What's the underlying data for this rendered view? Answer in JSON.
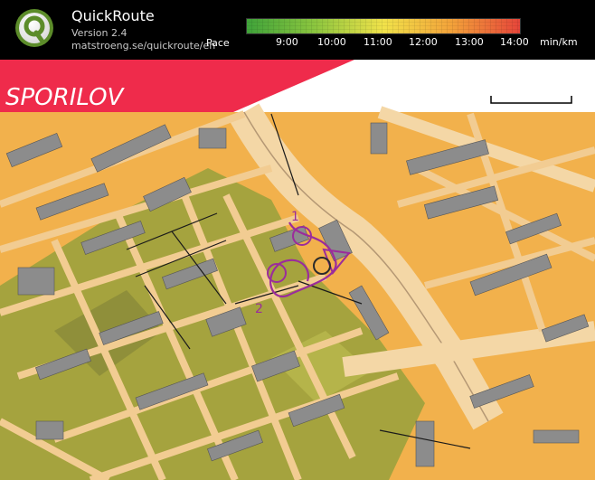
{
  "app": {
    "title": "QuickRoute",
    "version": "Version 2.4",
    "url": "matstroeng.se/quickroute/en"
  },
  "legend": {
    "label": "Pace",
    "ticks": [
      "9:00",
      "10:00",
      "11:00",
      "12:00",
      "13:00",
      "14:00"
    ],
    "unit": "min/km",
    "colors": [
      "#3fa33a",
      "#8cc63f",
      "#f1e24a",
      "#f3a23a",
      "#e6453a"
    ]
  },
  "map": {
    "title": "SPORILOV",
    "controls": [
      "1",
      "2"
    ],
    "colors": {
      "banner": "#ef2b4b",
      "buildings": "#8b8b8b",
      "roads": "#f2cc92",
      "open": "#f4b24a",
      "vegetation": "#a6a43f",
      "route": "#9b2c9b"
    }
  }
}
